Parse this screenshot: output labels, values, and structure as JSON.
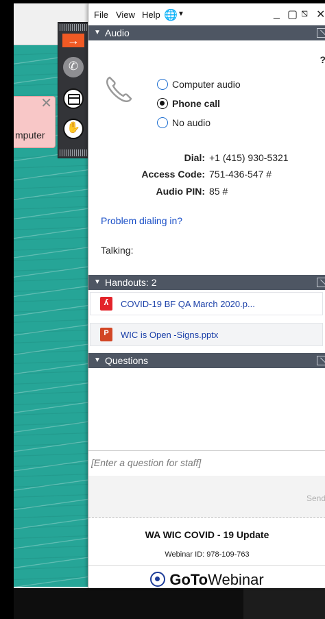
{
  "background": {
    "popup_text": "mputer",
    "popup_close": "✕"
  },
  "menubar": {
    "file": "File",
    "view": "View",
    "help": "Help",
    "minimize": "_",
    "restore": "▢",
    "popout": "⧅",
    "close": "✕"
  },
  "audio": {
    "title": "Audio",
    "help_mark": "?",
    "options": [
      {
        "label": "Computer audio",
        "selected": false
      },
      {
        "label": "Phone call",
        "selected": true
      },
      {
        "label": "No audio",
        "selected": false
      }
    ],
    "dial_label": "Dial:",
    "dial_value": "+1 (415) 930-5321",
    "access_label": "Access Code:",
    "access_value": "751-436-547 #",
    "pin_label": "Audio PIN:",
    "pin_value": "85 #",
    "problem_link": "Problem dialing in?",
    "talking": "Talking:"
  },
  "handouts": {
    "title": "Handouts: 2",
    "items": [
      {
        "name": "COVID-19 BF QA March 2020.p...",
        "type": "pdf"
      },
      {
        "name": "WIC is Open -Signs.pptx",
        "type": "pptx"
      }
    ]
  },
  "questions": {
    "title": "Questions",
    "placeholder": "[Enter a question for staff]",
    "send": "Send"
  },
  "footer": {
    "webinar_title": "WA WIC COVID - 19 Update",
    "webinar_id": "Webinar ID: 978-109-763",
    "brand_goto": "GoTo",
    "brand_webinar": "Webinar"
  },
  "colors": {
    "section_header": "#4e5663",
    "link": "#1a4fc7",
    "teal_bg": "#26a597",
    "arrow_orange": "#f15a24"
  }
}
